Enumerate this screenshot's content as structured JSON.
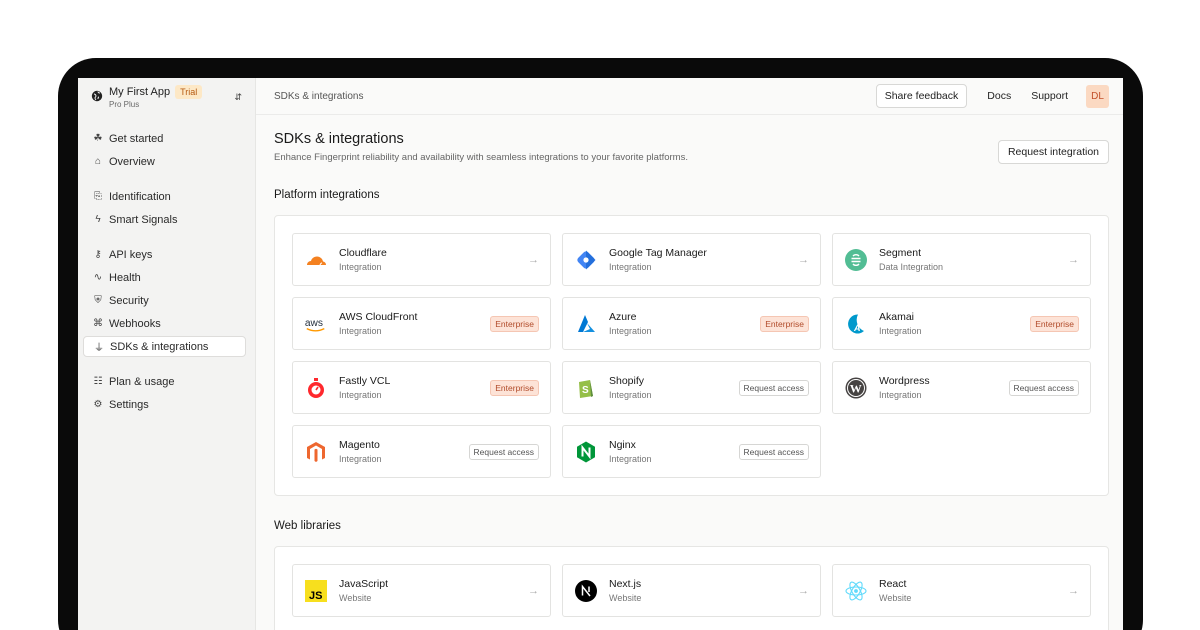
{
  "sidebar": {
    "app_name": "My First App",
    "trial_badge": "Trial",
    "plan": "Pro Plus",
    "groups": [
      [
        {
          "label": "Get started",
          "icon": "sprout-icon"
        },
        {
          "label": "Overview",
          "icon": "home-icon"
        }
      ],
      [
        {
          "label": "Identification",
          "icon": "fingerprint-icon"
        },
        {
          "label": "Smart Signals",
          "icon": "zap-icon"
        }
      ],
      [
        {
          "label": "API keys",
          "icon": "key-icon"
        },
        {
          "label": "Health",
          "icon": "activity-icon"
        },
        {
          "label": "Security",
          "icon": "shield-icon"
        },
        {
          "label": "Webhooks",
          "icon": "webhook-icon"
        },
        {
          "label": "SDKs & integrations",
          "icon": "plug-icon",
          "active": true
        }
      ],
      [
        {
          "label": "Plan & usage",
          "icon": "receipt-icon"
        },
        {
          "label": "Settings",
          "icon": "gear-icon"
        }
      ]
    ]
  },
  "topbar": {
    "breadcrumb": "SDKs & integrations",
    "share_feedback": "Share feedback",
    "docs": "Docs",
    "support": "Support",
    "avatar": "DL"
  },
  "page": {
    "title": "SDKs & integrations",
    "subtitle": "Enhance Fingerprint reliability and availability with seamless integrations to your favorite platforms.",
    "request_integration": "Request integration"
  },
  "platform": {
    "title": "Platform integrations",
    "cards": [
      {
        "name": "Cloudflare",
        "type": "Integration",
        "logo": "cloudflare",
        "action": "arrow"
      },
      {
        "name": "Google Tag Manager",
        "type": "Integration",
        "logo": "gtm",
        "action": "arrow"
      },
      {
        "name": "Segment",
        "type": "Data Integration",
        "logo": "segment",
        "action": "arrow"
      },
      {
        "name": "AWS CloudFront",
        "type": "Integration",
        "logo": "aws",
        "action": "Enterprise"
      },
      {
        "name": "Azure",
        "type": "Integration",
        "logo": "azure",
        "action": "Enterprise"
      },
      {
        "name": "Akamai",
        "type": "Integration",
        "logo": "akamai",
        "action": "Enterprise"
      },
      {
        "name": "Fastly VCL",
        "type": "Integration",
        "logo": "fastly",
        "action": "Enterprise"
      },
      {
        "name": "Shopify",
        "type": "Integration",
        "logo": "shopify",
        "action": "Request access"
      },
      {
        "name": "Wordpress",
        "type": "Integration",
        "logo": "wordpress",
        "action": "Request access"
      },
      {
        "name": "Magento",
        "type": "Integration",
        "logo": "magento",
        "action": "Request access"
      },
      {
        "name": "Nginx",
        "type": "Integration",
        "logo": "nginx",
        "action": "Request access"
      }
    ]
  },
  "web": {
    "title": "Web libraries",
    "cards": [
      {
        "name": "JavaScript",
        "type": "Website",
        "logo": "javascript",
        "action": "arrow"
      },
      {
        "name": "Next.js",
        "type": "Website",
        "logo": "nextjs",
        "action": "arrow"
      },
      {
        "name": "React",
        "type": "Website",
        "logo": "react",
        "action": "arrow"
      }
    ]
  },
  "colors": {
    "accent": "#f06a35",
    "enterprise_bg": "#fde3d7",
    "trial_bg": "#fde8c6"
  }
}
